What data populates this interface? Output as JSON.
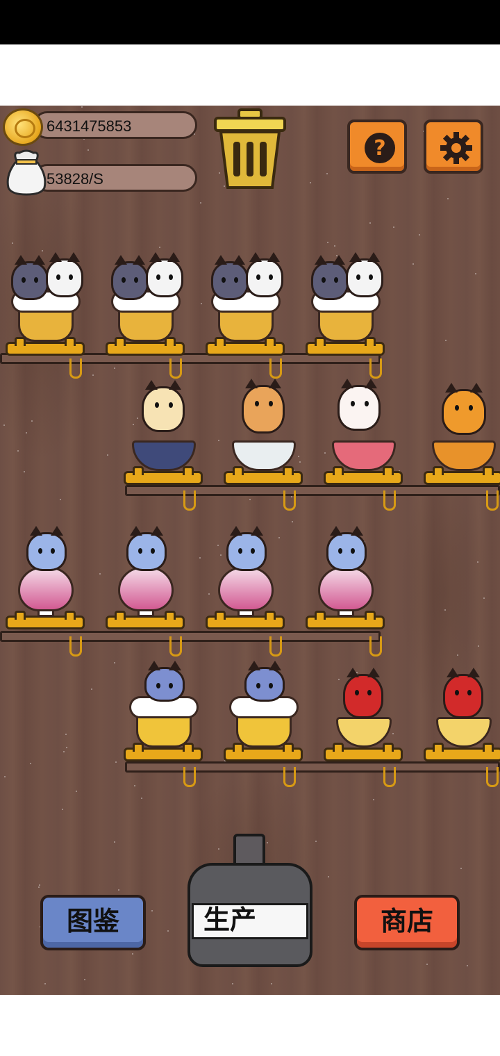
{
  "hud": {
    "coins": "6431475853",
    "income_rate": "53828/S",
    "icons": [
      "coin-icon",
      "money-bag-icon",
      "trash-can-icon",
      "help-icon",
      "settings-gear-icon"
    ]
  },
  "shelves": [
    {
      "row": 1,
      "items": [
        "beer-mug-cat-pair",
        "beer-mug-cat-pair",
        "beer-mug-cat-pair",
        "beer-mug-cat-pair"
      ]
    },
    {
      "row": 2,
      "items": [
        "teacup-calico-cat",
        "cloud-teacup-cat",
        "ramen-bowl-cat",
        "sombrero-orange-cat"
      ]
    },
    {
      "row": 3,
      "items": [
        "wine-glass-blue-cat",
        "wine-glass-blue-cat",
        "wine-glass-blue-cat",
        "wine-glass-blue-cat"
      ]
    },
    {
      "row": 4,
      "items": [
        "wizard-hat-mug-cat",
        "wizard-hat-mug-cat",
        "golden-heart-cat",
        "golden-heart-cat"
      ]
    }
  ],
  "buttons": {
    "collection": "图鉴",
    "produce": "生产",
    "shop": "商店"
  },
  "colors": {
    "wood": "#6e4f45",
    "orange_button": "#f08a2a",
    "blue_button": "#6a86c8",
    "red_button": "#f2603e",
    "gold": "#e8a81a"
  }
}
